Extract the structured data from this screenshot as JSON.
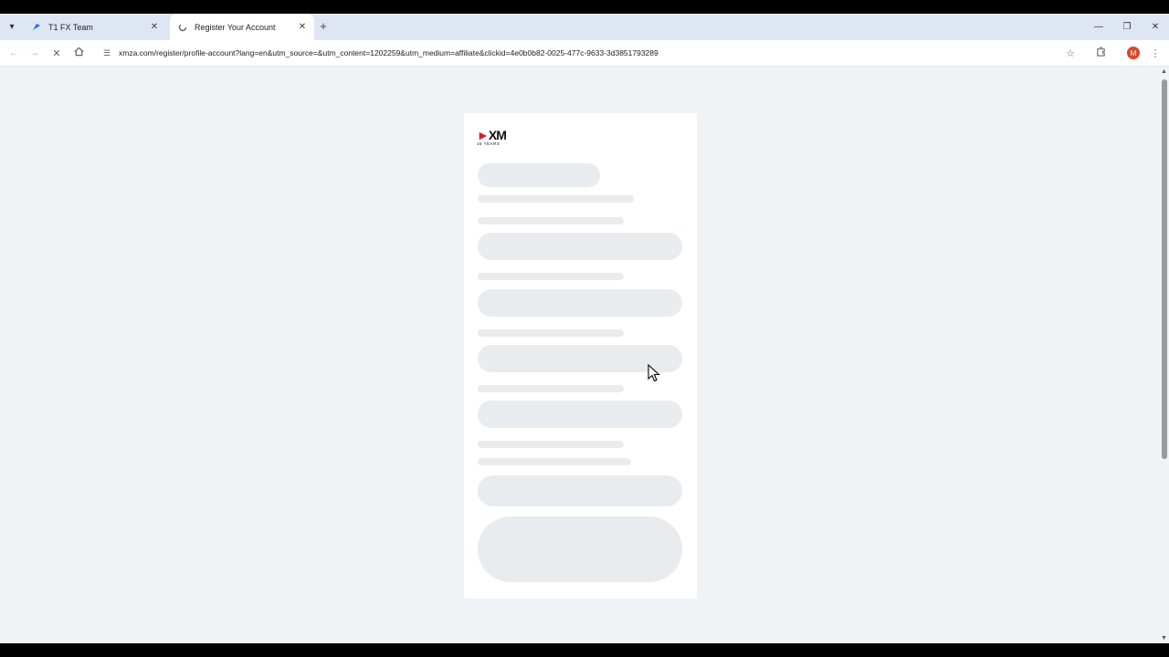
{
  "browser": {
    "tabs": [
      {
        "title": "T1 FX Team",
        "active": false,
        "favicon": "t1-favicon-icon"
      },
      {
        "title": "Register Your Account",
        "active": true,
        "favicon": "loading-icon"
      }
    ],
    "url": "xmza.com/register/profile-account?lang=en&utm_source=&utm_content=1202259&utm_medium=affiliate&clickid=4e0b0b82-0025-477c-9633-3d3851793289",
    "profile_initial": "M",
    "icons": {
      "tab_search": "chevron-down-icon",
      "new_tab": "plus-icon",
      "minimize": "minimize-icon",
      "restore": "restore-icon",
      "close": "close-icon",
      "back": "back-arrow-icon",
      "forward": "forward-arrow-icon",
      "stop": "stop-loading-icon",
      "home": "home-icon",
      "site_info": "site-info-icon",
      "bookmark": "star-icon",
      "extensions": "puzzle-icon",
      "menu": "kebab-menu-icon"
    }
  },
  "page": {
    "logo_text": "XM",
    "logo_subtext": "15 YEARS",
    "state": "loading-skeleton"
  },
  "colors": {
    "tabstrip": "#dfe6f3",
    "page_background": "#eff3f6",
    "skeleton": "#e8ecef",
    "logo_accent": "#d51f2b",
    "avatar": "#d9482b"
  }
}
